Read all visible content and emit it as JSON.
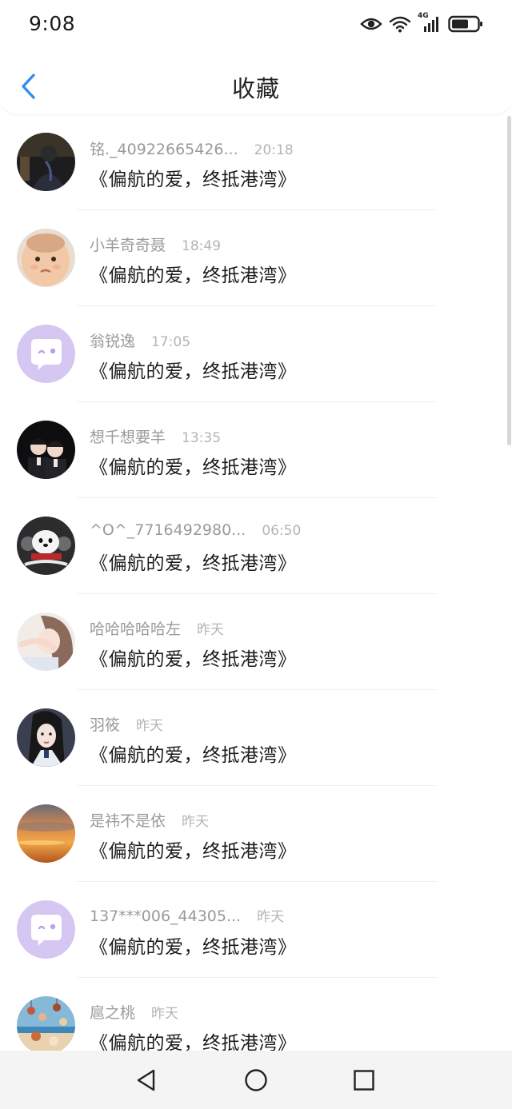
{
  "status_bar": {
    "time": "9:08",
    "network_label": "4G",
    "icons": [
      "eye-icon",
      "wifi-icon",
      "cellular-signal-icon",
      "battery-icon"
    ]
  },
  "nav": {
    "back_icon": "chevron-left-icon",
    "title": "收藏",
    "accent_color": "#2f8ff0"
  },
  "items": [
    {
      "name": "铭._40922665426...",
      "time": "20:18",
      "content": "《偏航的爱，终抵港湾》",
      "avatar": "dark-photo"
    },
    {
      "name": "小羊奇奇聂",
      "time": "18:49",
      "content": "《偏航的爱，终抵港湾》",
      "avatar": "baby-photo"
    },
    {
      "name": "翁锐逸",
      "time": "17:05",
      "content": "《偏航的爱，终抵港湾》",
      "avatar": "default-chat-bubble"
    },
    {
      "name": "想千想要羊",
      "time": "13:35",
      "content": "《偏航的爱，终抵港湾》",
      "avatar": "couple-photo"
    },
    {
      "name": "^O^_7716492980...",
      "time": "06:50",
      "content": "《偏航的爱，终抵港湾》",
      "avatar": "cartoon-dog"
    },
    {
      "name": "哈哈哈哈哈左",
      "time": "昨天",
      "content": "《偏航的爱，终抵港湾》",
      "avatar": "girl-photo"
    },
    {
      "name": "羽筱",
      "time": "昨天",
      "content": "《偏航的爱，终抵港湾》",
      "avatar": "girl-dark-photo"
    },
    {
      "name": "是祎不是依",
      "time": "昨天",
      "content": "《偏航的爱，终抵港湾》",
      "avatar": "sunset-photo"
    },
    {
      "name": "137***006_44305...",
      "time": "昨天",
      "content": "《偏航的爱，终抵港湾》",
      "avatar": "default-chat-bubble"
    },
    {
      "name": "扈之桃",
      "time": "昨天",
      "content": "《偏航的爱，终抵港湾》",
      "avatar": "beach-photo"
    }
  ],
  "system_nav": [
    "back-triangle-icon",
    "home-circle-icon",
    "recents-square-icon"
  ]
}
